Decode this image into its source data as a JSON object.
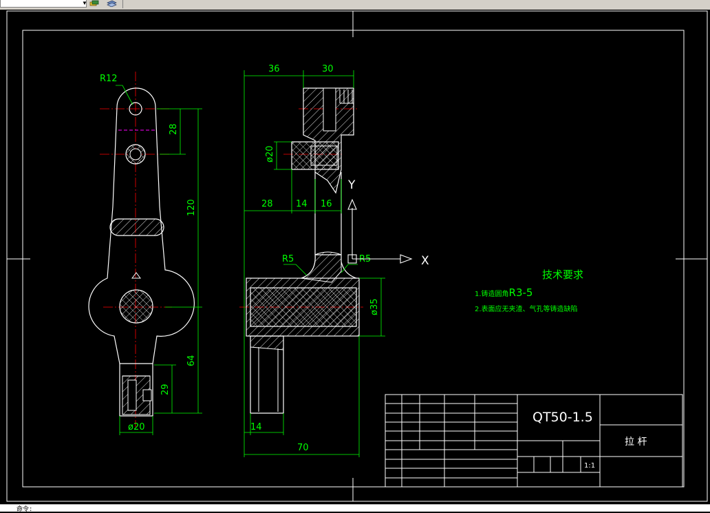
{
  "toolbar": {
    "layer_combo_value": "",
    "icons": [
      "layer-states-icon",
      "layer-tools-icon"
    ]
  },
  "drawing": {
    "views": {
      "front": {
        "dims": {
          "r12": "R12",
          "d28": "28",
          "d120": "120",
          "d64": "64",
          "d29": "29",
          "dia20": "ø20"
        }
      },
      "side": {
        "dims": {
          "d36": "36",
          "d30": "30",
          "dia20": "ø20",
          "d28": "28",
          "d14a": "14",
          "d16": "16",
          "r5a": "R5",
          "r5b": "R5",
          "dia35": "ø35",
          "d14b": "14",
          "d70": "70"
        }
      }
    },
    "ucs": {
      "x": "X",
      "y": "Y"
    },
    "tech_req": {
      "title": "技术要求",
      "line1_prefix": "1.铸造圆角",
      "line1_value": "R3-5",
      "line2": "2.表面应无夹渣、气孔等铸造缺陷"
    },
    "title_block": {
      "material": "QT50-1.5",
      "part_name": "拉 杆",
      "scale": "1:1"
    },
    "colors": {
      "outline": "#ffffff",
      "dimension": "#00ff00",
      "centerline": "#ff0000",
      "hidden": "#ff00ff",
      "ucs": "#ffffff"
    }
  },
  "status": {
    "text": "命令:"
  }
}
